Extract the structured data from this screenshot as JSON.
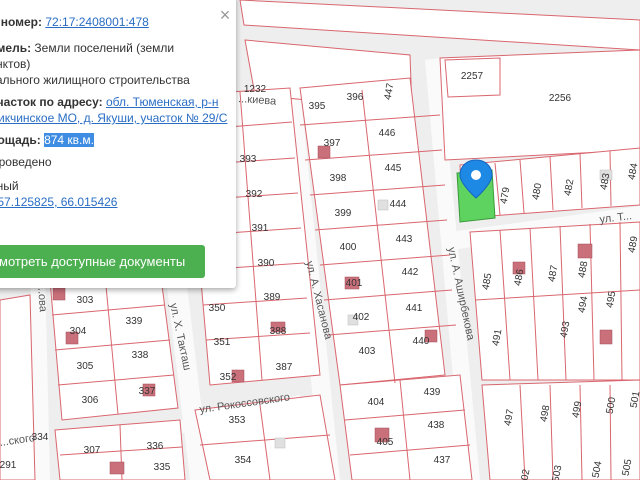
{
  "map": {
    "streets": {
      "hasanova": "ул. А. Хасанова",
      "ashirbekova": "ул. А. Аширбекова",
      "taktash": "ул. Х. Такташ",
      "rokossovskogo": "ул. Рокоссовского",
      "partial_top_right": "ул. Т...",
      "partial_top": "...киева",
      "partial_left": "...ова",
      "partial_bottom_left": "...ского"
    },
    "parcels": [
      "2257",
      "2256",
      "1232",
      "395",
      "396",
      "447",
      "446",
      "445",
      "444",
      "443",
      "442",
      "441",
      "440",
      "397",
      "398",
      "399",
      "400",
      "401",
      "402",
      "403",
      "393",
      "392",
      "391",
      "390",
      "389",
      "388",
      "387",
      "350",
      "351",
      "352",
      "303",
      "304",
      "305",
      "306",
      "339",
      "338",
      "337",
      "336",
      "335",
      "334",
      "353",
      "354",
      "307",
      "291",
      "479",
      "480",
      "482",
      "483",
      "484",
      "485",
      "486",
      "487",
      "488",
      "489",
      "491",
      "493",
      "494",
      "495",
      "404",
      "405",
      "439",
      "438",
      "437",
      "497",
      "498",
      "499",
      "500",
      "501",
      "502",
      "503",
      "504",
      "505",
      "506",
      "505",
      "503",
      "504"
    ],
    "selected_parcel": "29/С",
    "marker_color": "#1e88e5",
    "selected_fill": "#5fd35f",
    "parcel_border": "#d9666e"
  },
  "popup": {
    "cadastral_label": "й номер:",
    "cadastral_value": "72:17:2408001:478",
    "category_label": "емель:",
    "category_value": "Земли поселений (земли",
    "category_value_2": "унктов)",
    "use_value": "уального жилищного строительства",
    "address_label": "участок по адресу:",
    "address_value_1": "обл. Тюменская, р-н",
    "address_value_2": "Чикчинское МО, д. Якуши, участок № 29/С",
    "area_label": "лощадь:",
    "area_value": "874 кв.м.",
    "status_value": "Проведено",
    "state_value": "нный",
    "coords_label": ":",
    "coords_value": "57.125825, 66.015426",
    "button_label": "мотреть доступные документы",
    "close_symbol": "×"
  }
}
